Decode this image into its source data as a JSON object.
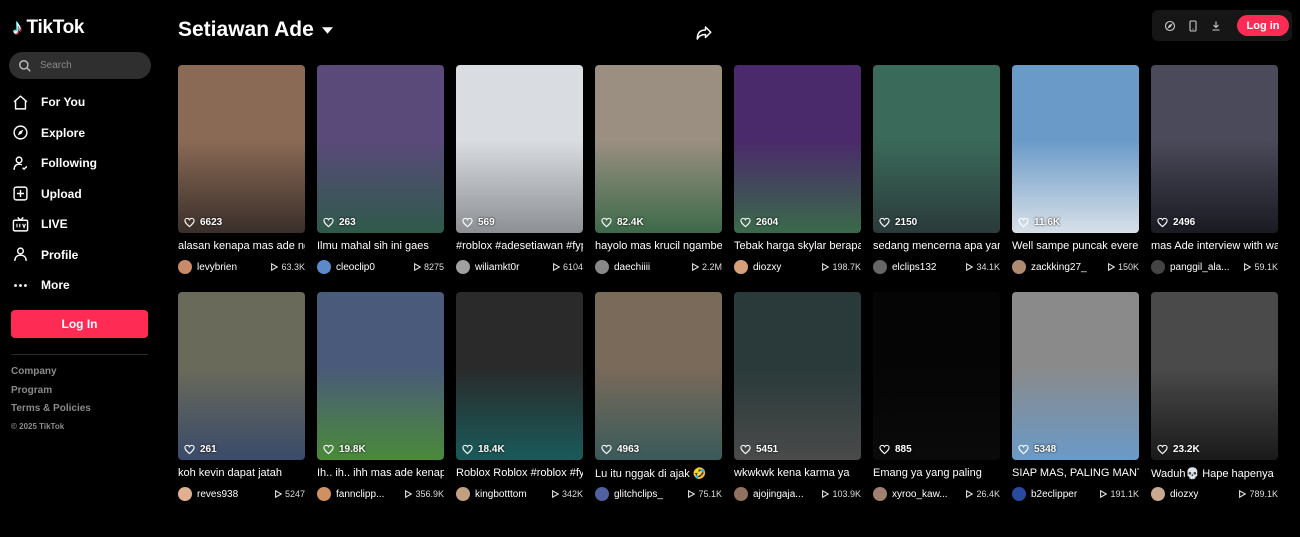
{
  "app": {
    "logo_text": "TikTok"
  },
  "search": {
    "placeholder": "Search"
  },
  "nav": [
    {
      "label": "For You",
      "icon": "home-icon"
    },
    {
      "label": "Explore",
      "icon": "compass-icon"
    },
    {
      "label": "Following",
      "icon": "following-icon"
    },
    {
      "label": "Upload",
      "icon": "upload-icon"
    },
    {
      "label": "LIVE",
      "icon": "live-icon"
    },
    {
      "label": "Profile",
      "icon": "profile-icon"
    },
    {
      "label": "More",
      "icon": "more-icon"
    }
  ],
  "sidebar": {
    "login_label": "Log In"
  },
  "footer": {
    "company": "Company",
    "program": "Program",
    "terms": "Terms & Policies",
    "copyright": "© 2025 TikTok"
  },
  "header": {
    "title": "Setiawan Ade",
    "login_label": "Log in"
  },
  "colors": {
    "accent": "#fe2c55",
    "background": "#000000",
    "search_bg": "#2f2f2f"
  },
  "videos": [
    {
      "likes": "6623",
      "caption": "alasan kenapa mas ade ngelawak aja lucu",
      "user": "levybrien",
      "views": "63.3K",
      "c1": "#8a6a55",
      "c2": "#3a2f2a"
    },
    {
      "likes": "263",
      "caption": "Ilmu mahal sih ini gaes",
      "user": "cleoclip0",
      "views": "8275",
      "c1": "#5a4a7a",
      "c2": "#2e5a4a"
    },
    {
      "likes": "569",
      "caption": "#roblox #adesetiawan #fyp",
      "user": "wiliamkt0r",
      "views": "6104",
      "c1": "#d9dde2",
      "c2": "#8c8f94"
    },
    {
      "likes": "82.4K",
      "caption": "hayolo mas krucil ngamber",
      "user": "daechiiii",
      "views": "2.2M",
      "c1": "#9a8f80",
      "c2": "#3d6a4a"
    },
    {
      "likes": "2604",
      "caption": "Tebak harga skylar berapa",
      "user": "diozxy",
      "views": "198.7K",
      "c1": "#4a2a6a",
      "c2": "#3a6a4a"
    },
    {
      "likes": "2150",
      "caption": "sedang mencerna apa yang terjadi",
      "user": "elclips132",
      "views": "34.1K",
      "c1": "#3a6a5a",
      "c2": "#2a3a3a"
    },
    {
      "likes": "11.6K",
      "caption": "Well sampe puncak everest",
      "user": "zackking27_",
      "views": "150K",
      "c1": "#6a9ac8",
      "c2": "#d8e0e8"
    },
    {
      "likes": "2496",
      "caption": "mas Ade interview with wartawan",
      "user": "panggil_ala...",
      "views": "59.1K",
      "c1": "#4a4a5a",
      "c2": "#1a1a22"
    },
    {
      "likes": "261",
      "caption": "koh kevin dapat jatah",
      "user": "reves938",
      "views": "5247",
      "c1": "#6a6a5a",
      "c2": "#3a4a6a"
    },
    {
      "likes": "19.8K",
      "caption": "Ih.. ih.. ihh mas ade kenapa",
      "user": "fannclipp...",
      "views": "356.9K",
      "c1": "#4a5a7a",
      "c2": "#4a8a3a"
    },
    {
      "likes": "18.4K",
      "caption": "Roblox Roblox #roblox #fyp",
      "user": "kingbotttom",
      "views": "342K",
      "c1": "#2a2a2a",
      "c2": "#1a5a5a"
    },
    {
      "likes": "4963",
      "caption": "Lu itu nggak di ajak 🤣",
      "user": "glitchclips_",
      "views": "75.1K",
      "c1": "#7a6a5a",
      "c2": "#3a5a5a"
    },
    {
      "likes": "5451",
      "caption": "wkwkwk kena karma ya",
      "user": "ajojingaja...",
      "views": "103.9K",
      "c1": "#2a3a3a",
      "c2": "#4a4a4a"
    },
    {
      "likes": "885",
      "caption": "Emang ya yang paling",
      "user": "xyroo_kaw...",
      "views": "26.4K",
      "c1": "#050505",
      "c2": "#0a0a0a"
    },
    {
      "likes": "5348",
      "caption": "SIAP MAS, PALING MANTAP",
      "user": "b2eclipper",
      "views": "191.1K",
      "c1": "#8a8a8a",
      "c2": "#6a9ac8"
    },
    {
      "likes": "23.2K",
      "caption": "Waduh💀 Hape hapenya",
      "user": "diozxy",
      "views": "789.1K",
      "c1": "#4a4a4a",
      "c2": "#1a1a1a"
    }
  ]
}
